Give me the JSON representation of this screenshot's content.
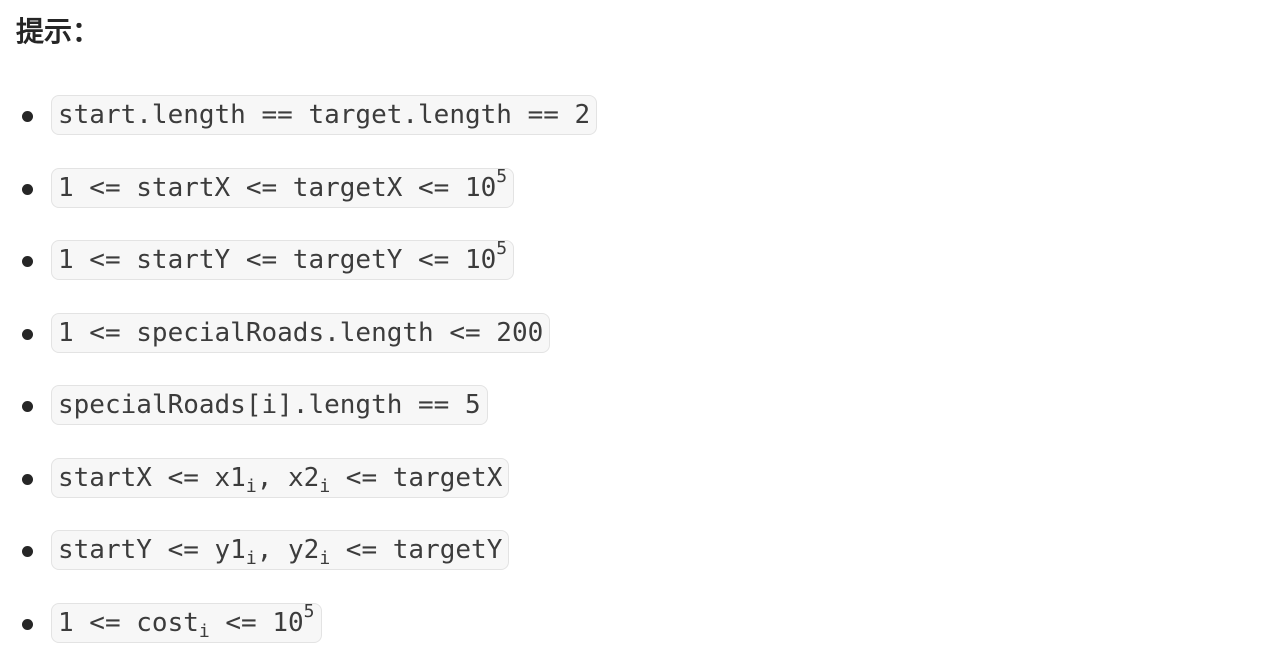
{
  "heading": "提示：",
  "constraints": [
    {
      "parts": [
        {
          "t": "start.length == target.length == 2"
        }
      ]
    },
    {
      "parts": [
        {
          "t": "1 <= startX <= targetX <= 10"
        },
        {
          "t": "5",
          "sup": true
        }
      ]
    },
    {
      "parts": [
        {
          "t": "1 <= startY <= targetY <= 10"
        },
        {
          "t": "5",
          "sup": true
        }
      ]
    },
    {
      "parts": [
        {
          "t": "1 <= specialRoads.length <= 200"
        }
      ]
    },
    {
      "parts": [
        {
          "t": "specialRoads[i].length == 5"
        }
      ]
    },
    {
      "parts": [
        {
          "t": "startX <= x1"
        },
        {
          "t": "i",
          "sub": true
        },
        {
          "t": ", x2"
        },
        {
          "t": "i",
          "sub": true
        },
        {
          "t": " <= targetX"
        }
      ]
    },
    {
      "parts": [
        {
          "t": "startY <= y1"
        },
        {
          "t": "i",
          "sub": true
        },
        {
          "t": ", y2"
        },
        {
          "t": "i",
          "sub": true
        },
        {
          "t": " <= targetY"
        }
      ]
    },
    {
      "parts": [
        {
          "t": "1 <= cost"
        },
        {
          "t": "i",
          "sub": true
        },
        {
          "t": " <= 10"
        },
        {
          "t": "5",
          "sup": true
        }
      ]
    }
  ]
}
